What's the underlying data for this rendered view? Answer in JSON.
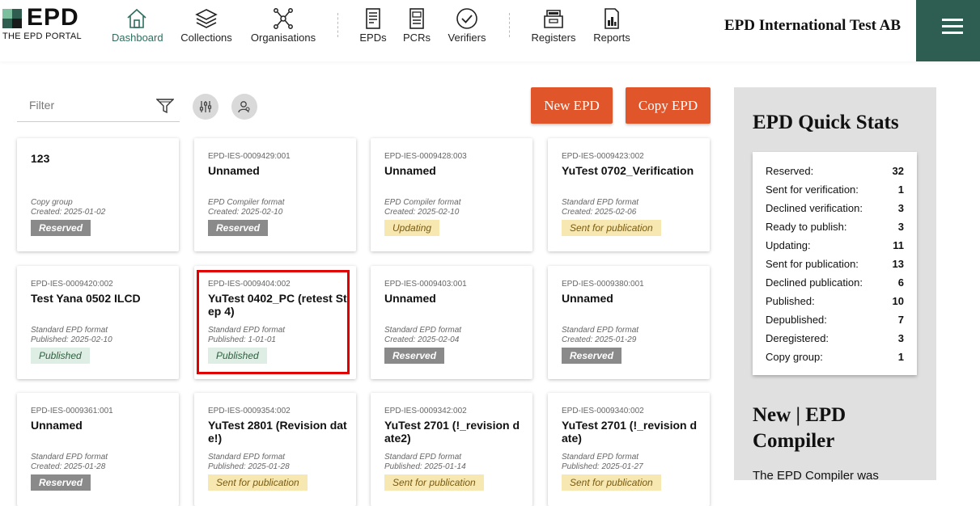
{
  "logo": {
    "text": "EPD",
    "subtitle": "THE EPD PORTAL"
  },
  "nav": [
    {
      "label": "Dashboard",
      "icon": "home-icon",
      "active": true
    },
    {
      "label": "Collections",
      "icon": "layers-icon"
    },
    {
      "label": "Organisations",
      "icon": "network-icon"
    },
    {
      "label": "EPDs",
      "icon": "epd-document-icon"
    },
    {
      "label": "PCRs",
      "icon": "pcr-document-icon"
    },
    {
      "label": "Verifiers",
      "icon": "check-circle-icon"
    },
    {
      "label": "Registers",
      "icon": "register-icon"
    },
    {
      "label": "Reports",
      "icon": "report-chart-icon"
    }
  ],
  "org_name": "EPD International Test AB",
  "filter": {
    "placeholder": "Filter"
  },
  "buttons": {
    "new_epd": "New EPD",
    "copy_epd": "Copy EPD"
  },
  "cards": [
    {
      "id": "",
      "title": "123",
      "format": "Copy group",
      "date": "Created: 2025-01-02",
      "status": "Reserved",
      "status_type": "reserved"
    },
    {
      "id": "EPD-IES-0009429:001",
      "title": "Unnamed",
      "format": "EPD Compiler format",
      "date": "Created: 2025-02-10",
      "status": "Reserved",
      "status_type": "reserved"
    },
    {
      "id": "EPD-IES-0009428:003",
      "title": "Unnamed",
      "format": "EPD Compiler format",
      "date": "Created: 2025-02-10",
      "status": "Updating",
      "status_type": "updating"
    },
    {
      "id": "EPD-IES-0009423:002",
      "title": "YuTest 0702_Verification",
      "format": "Standard EPD format",
      "date": "Created: 2025-02-06",
      "status": "Sent for publication",
      "status_type": "sent"
    },
    {
      "id": "EPD-IES-0009420:002",
      "title": "Test Yana 0502 ILCD",
      "format": "Standard EPD format",
      "date": "Published: 2025-02-10",
      "status": "Published",
      "status_type": "published"
    },
    {
      "id": "EPD-IES-0009404:002",
      "title": "YuTest 0402_PC (retest Step 4)",
      "format": "Standard EPD format",
      "date": "Published: 1-01-01",
      "status": "Published",
      "status_type": "published"
    },
    {
      "id": "EPD-IES-0009403:001",
      "title": "Unnamed",
      "format": "Standard EPD format",
      "date": "Created: 2025-02-04",
      "status": "Reserved",
      "status_type": "reserved"
    },
    {
      "id": "EPD-IES-0009380:001",
      "title": "Unnamed",
      "format": "Standard EPD format",
      "date": "Created: 2025-01-29",
      "status": "Reserved",
      "status_type": "reserved"
    },
    {
      "id": "EPD-IES-0009361:001",
      "title": "Unnamed",
      "format": "Standard EPD format",
      "date": "Created: 2025-01-28",
      "status": "Reserved",
      "status_type": "reserved"
    },
    {
      "id": "EPD-IES-0009354:002",
      "title": "YuTest 2801 (Revision date!)",
      "format": "Standard EPD format",
      "date": "Published: 2025-01-28",
      "status": "Sent for publication",
      "status_type": "sent"
    },
    {
      "id": "EPD-IES-0009342:002",
      "title": "YuTest 2701 (!_revision date2)",
      "format": "Standard EPD format",
      "date": "Published: 2025-01-14",
      "status": "Sent for publication",
      "status_type": "sent"
    },
    {
      "id": "EPD-IES-0009340:002",
      "title": "YuTest 2701 (!_revision date)",
      "format": "Standard EPD format",
      "date": "Published: 2025-01-27",
      "status": "Sent for publication",
      "status_type": "sent"
    }
  ],
  "stats": {
    "title": "EPD Quick Stats",
    "rows": [
      {
        "label": "Reserved:",
        "value": "32"
      },
      {
        "label": "Sent for verification:",
        "value": "1"
      },
      {
        "label": "Declined verification:",
        "value": "3"
      },
      {
        "label": "Ready to publish:",
        "value": "3"
      },
      {
        "label": "Updating:",
        "value": "11"
      },
      {
        "label": "Sent for publication:",
        "value": "13"
      },
      {
        "label": "Declined publication:",
        "value": "6"
      },
      {
        "label": "Published:",
        "value": "10"
      },
      {
        "label": "Depublished:",
        "value": "7"
      },
      {
        "label": "Deregistered:",
        "value": "3"
      },
      {
        "label": "Copy group:",
        "value": "1"
      }
    ]
  },
  "compiler": {
    "title": "New | EPD Compiler",
    "text": "The EPD Compiler was"
  },
  "colors": {
    "accent_green": "#2e5e52",
    "orange": "#e0562a",
    "highlight_red": "#e00000"
  }
}
